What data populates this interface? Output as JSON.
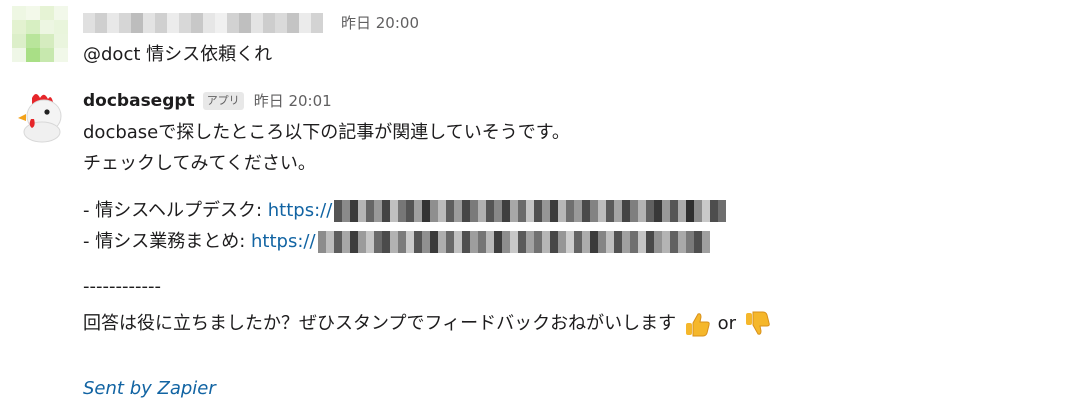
{
  "message1": {
    "timestamp": "昨日 20:00",
    "text": "@doct 情シス依頼くれ"
  },
  "message2": {
    "sender": "docbasegpt",
    "badge": "アプリ",
    "timestamp": "昨日 20:01",
    "line1": "docbaseで探したところ以下の記事が関連していそうです。",
    "line2": "チェックしてみてください。",
    "item1_label": "- 情シスヘルプデスク: ",
    "item1_link": "https://",
    "item2_label": "- 情シス業務まとめ: ",
    "item2_link": "https://",
    "separator": "------------",
    "question": "回答は役に立ちましたか？ぜひスタンプでフィードバックおねがいします",
    "or_text": "or",
    "footer": "Sent by Zapier",
    "icons": {
      "avatar": "chicken-icon",
      "up": "thumbs-up-icon",
      "down": "thumbs-down-icon"
    }
  },
  "colors": {
    "link": "#1264a3",
    "muted": "#616061",
    "text": "#1d1c1d"
  }
}
